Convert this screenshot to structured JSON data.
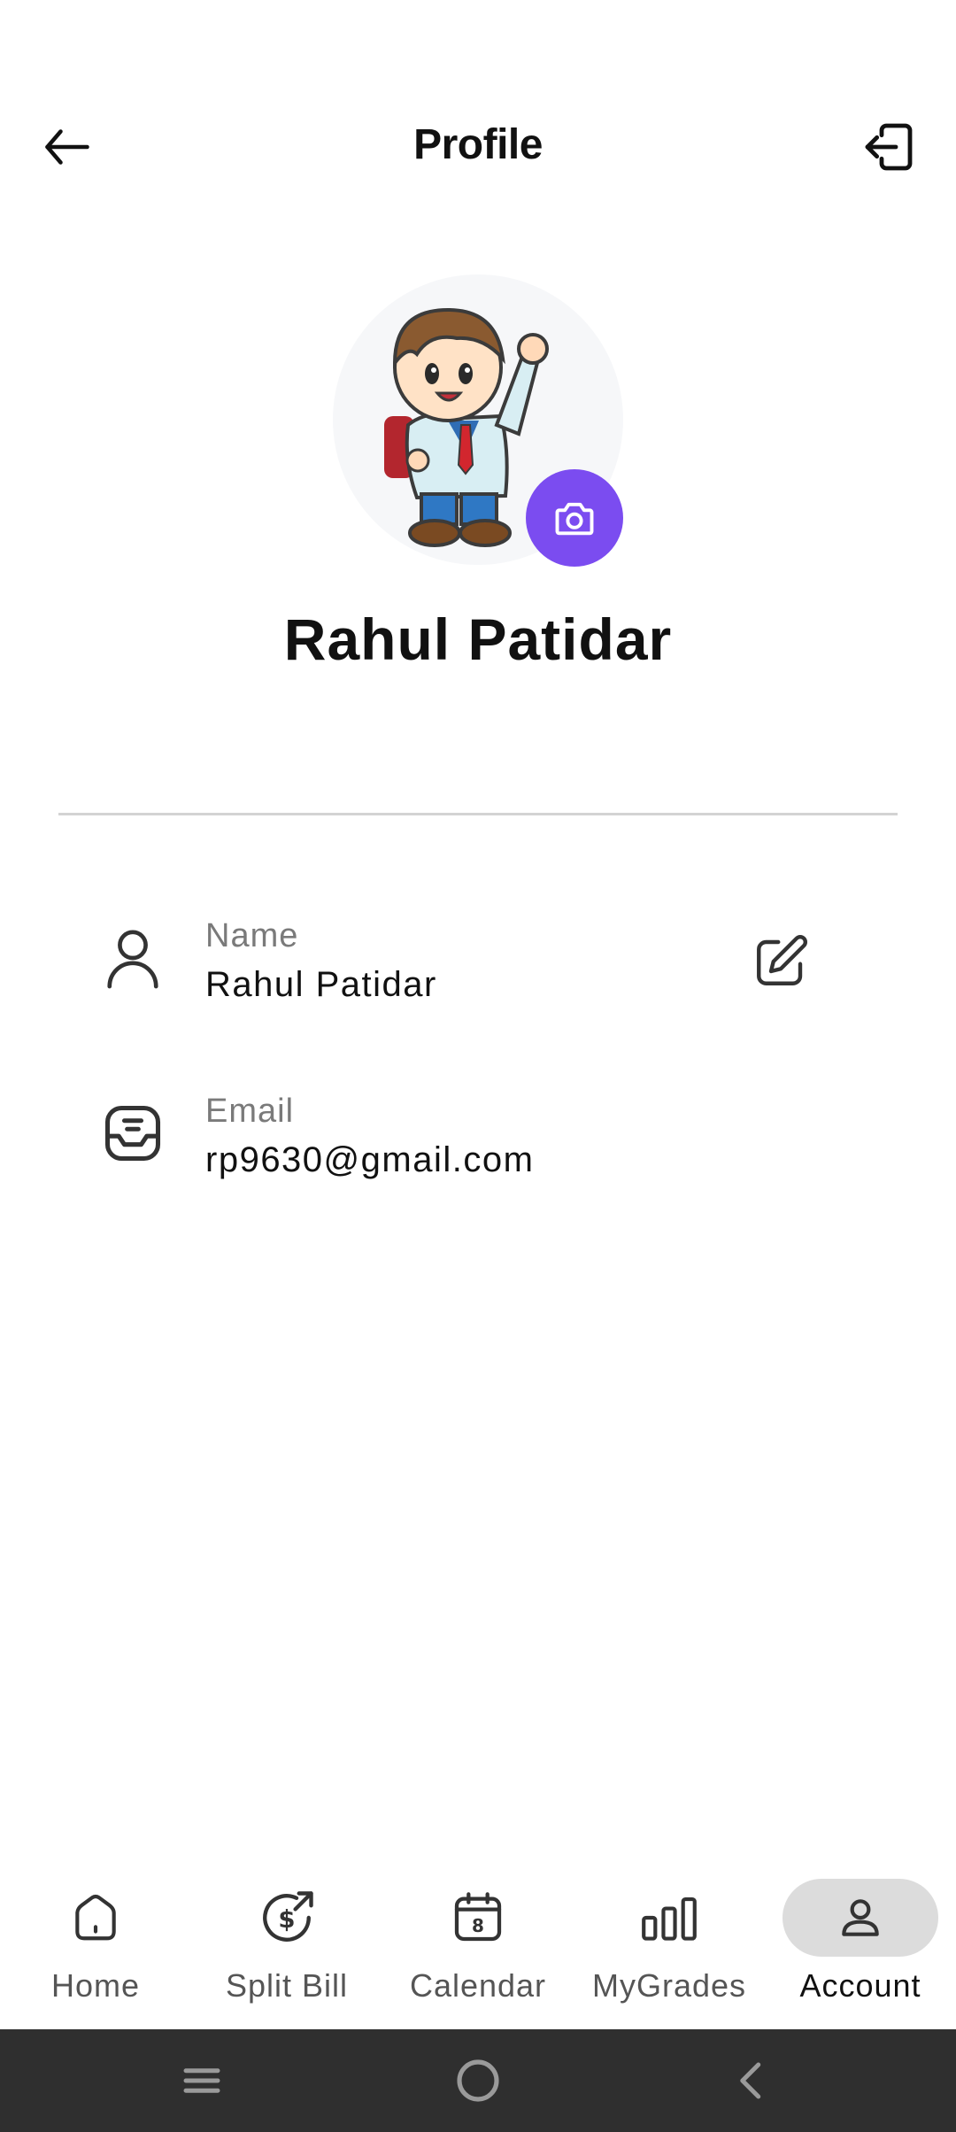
{
  "header": {
    "title": "Profile"
  },
  "profile": {
    "display_name": "Rahul  Patidar"
  },
  "info": {
    "name": {
      "label": "Name",
      "value": "Rahul  Patidar"
    },
    "email": {
      "label": "Email",
      "value": "rp9630@gmail.com"
    }
  },
  "bottom_nav": {
    "items": [
      {
        "label": "Home",
        "icon": "home-icon"
      },
      {
        "label": "Split Bill",
        "icon": "split-bill-icon"
      },
      {
        "label": "Calendar",
        "icon": "calendar-icon",
        "badge": "8"
      },
      {
        "label": "MyGrades",
        "icon": "bar-chart-icon"
      },
      {
        "label": "Account",
        "icon": "account-icon",
        "active": true
      }
    ]
  },
  "colors": {
    "accent": "#7b4cf0",
    "active_nav_bg": "#dcdcdc",
    "system_bar": "#2f2f2f"
  }
}
